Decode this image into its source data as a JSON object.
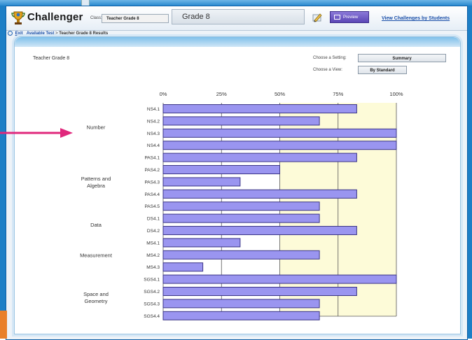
{
  "app": {
    "title": "Challenger",
    "class_label": "Class:",
    "class_value": "Teacher Grade 8",
    "grade": "Grade 8",
    "preview_label": "Preview",
    "view_by_students": "View Challenges by Students"
  },
  "breadcrumb": {
    "exit": "Exit",
    "available": "Available Test",
    "separator": ">",
    "current": "Teacher Grade 8 Results"
  },
  "panel": {
    "title": "Teacher Grade 8",
    "setting_label": "Choose a Setting:",
    "setting_value": "Summary",
    "view_label": "Choose a View:",
    "view_value": "By Standard"
  },
  "colors": {
    "bar_fill": "#9a95f0",
    "bar_stroke": "#3a3486",
    "highlight_band": "#fdfbd8",
    "arrow": "#e0287c",
    "accent": "#1d7fc6"
  },
  "chart_data": {
    "type": "bar",
    "orientation": "horizontal",
    "x_ticks": [
      "0%",
      "25%",
      "50%",
      "75%",
      "100%"
    ],
    "xlim": [
      0,
      100
    ],
    "categories": [
      "NS4.1",
      "NS4.2",
      "NS4.3",
      "NS4.4",
      "PAS4.1",
      "PAS4.2",
      "PAS4.3",
      "PAS4.4",
      "PAS4.5",
      "DS4.1",
      "DS4.2",
      "MS4.1",
      "MS4.2",
      "MS4.3",
      "SGS4.1",
      "SGS4.2",
      "SGS4.3",
      "SGS4.4"
    ],
    "values": [
      83,
      67,
      100,
      100,
      83,
      50,
      33,
      83,
      67,
      67,
      83,
      33,
      67,
      17,
      100,
      83,
      67,
      67
    ],
    "groups": [
      {
        "label": "Number",
        "first": 0,
        "last": 3
      },
      {
        "label": "Patterns and Algebra",
        "first": 4,
        "last": 8
      },
      {
        "label": "Data",
        "first": 9,
        "last": 10
      },
      {
        "label": "Measurement",
        "first": 11,
        "last": 13
      },
      {
        "label": "Space and Geometry",
        "first": 14,
        "last": 17
      }
    ],
    "highlight_from": 50,
    "grid": true
  }
}
